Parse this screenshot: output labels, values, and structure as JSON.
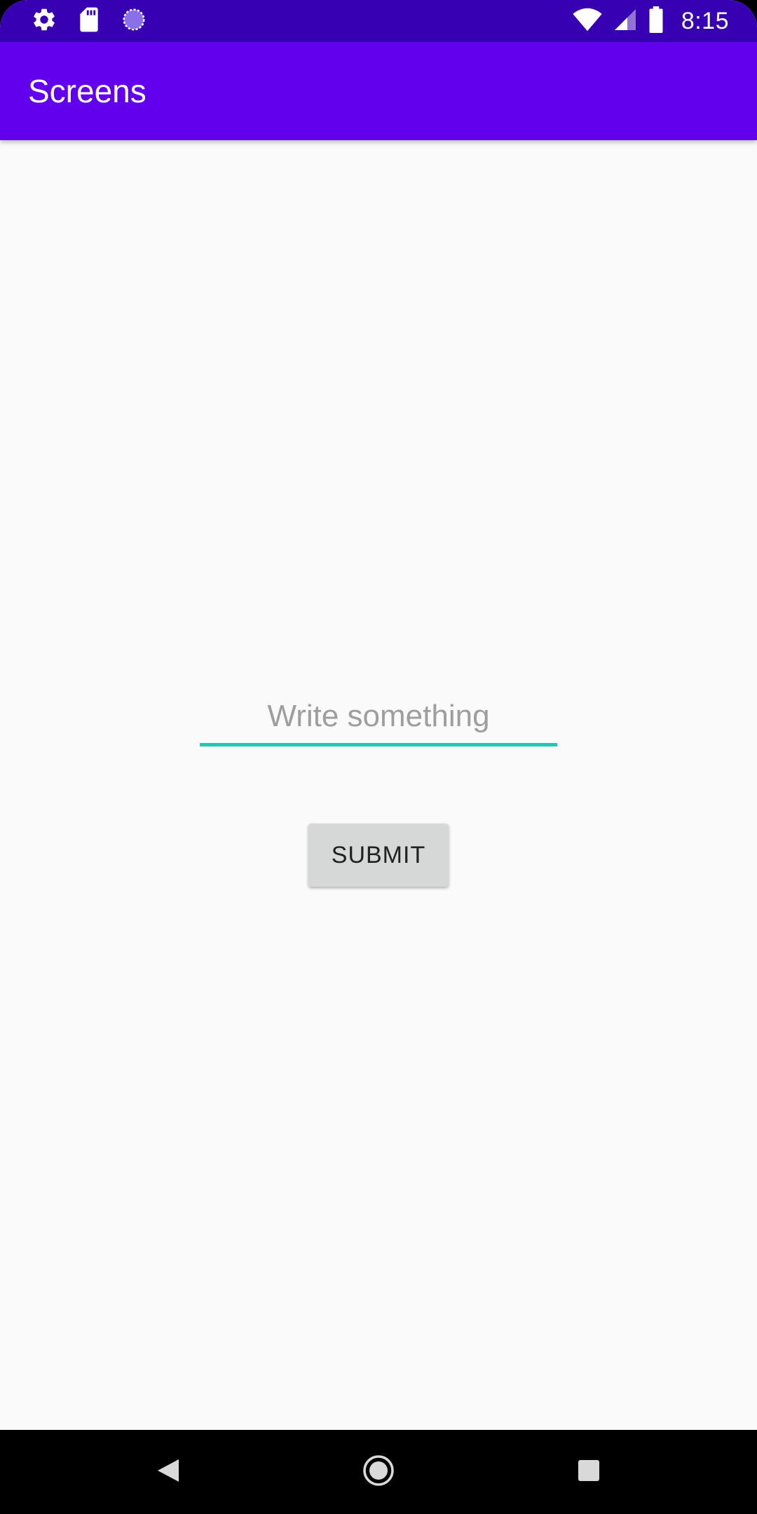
{
  "status_bar": {
    "time": "8:15",
    "left_icons": [
      "gear-icon",
      "sd-card-icon",
      "sync-circle-icon"
    ],
    "right_icons": [
      "wifi-icon",
      "cell-signal-icon",
      "battery-icon"
    ]
  },
  "app_bar": {
    "title": "Screens"
  },
  "form": {
    "input_placeholder": "Write something",
    "input_value": "",
    "submit_label": "SUBMIT"
  },
  "nav_bar": {
    "buttons": [
      "back-icon",
      "home-icon",
      "recents-icon"
    ]
  },
  "colors": {
    "status_bar": "#3700b3",
    "app_bar": "#6200ee",
    "background": "#fafafa",
    "input_underline": "#26c6b4",
    "button_bg": "#d6d7d7"
  }
}
